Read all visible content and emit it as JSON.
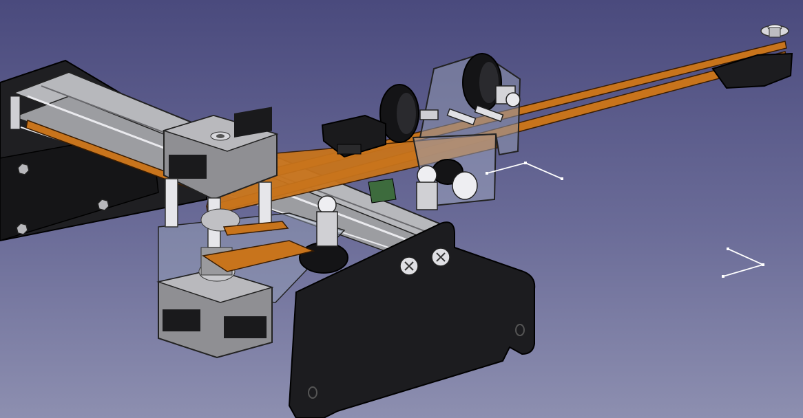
{
  "viewport": {
    "background_top": "#4a4a7d",
    "background_bottom": "#8d8fb0"
  },
  "scene": {
    "components": [
      "stepper-motor-top",
      "stepper-motor-bottom",
      "aluminium-extrusion-rail",
      "timing-belt",
      "carriage-plate",
      "idler-pulley",
      "end-stop-switch",
      "frame-side-plate"
    ]
  },
  "colors": {
    "belt": "#c8741c",
    "belt_edge": "#7a3d05",
    "black_part": "#1c1c1f",
    "metal_light": "#cfcfd3",
    "metal_dark": "#6e6e72",
    "motor_body": "#8f8f93",
    "acrylic": "#9aa3bb"
  }
}
